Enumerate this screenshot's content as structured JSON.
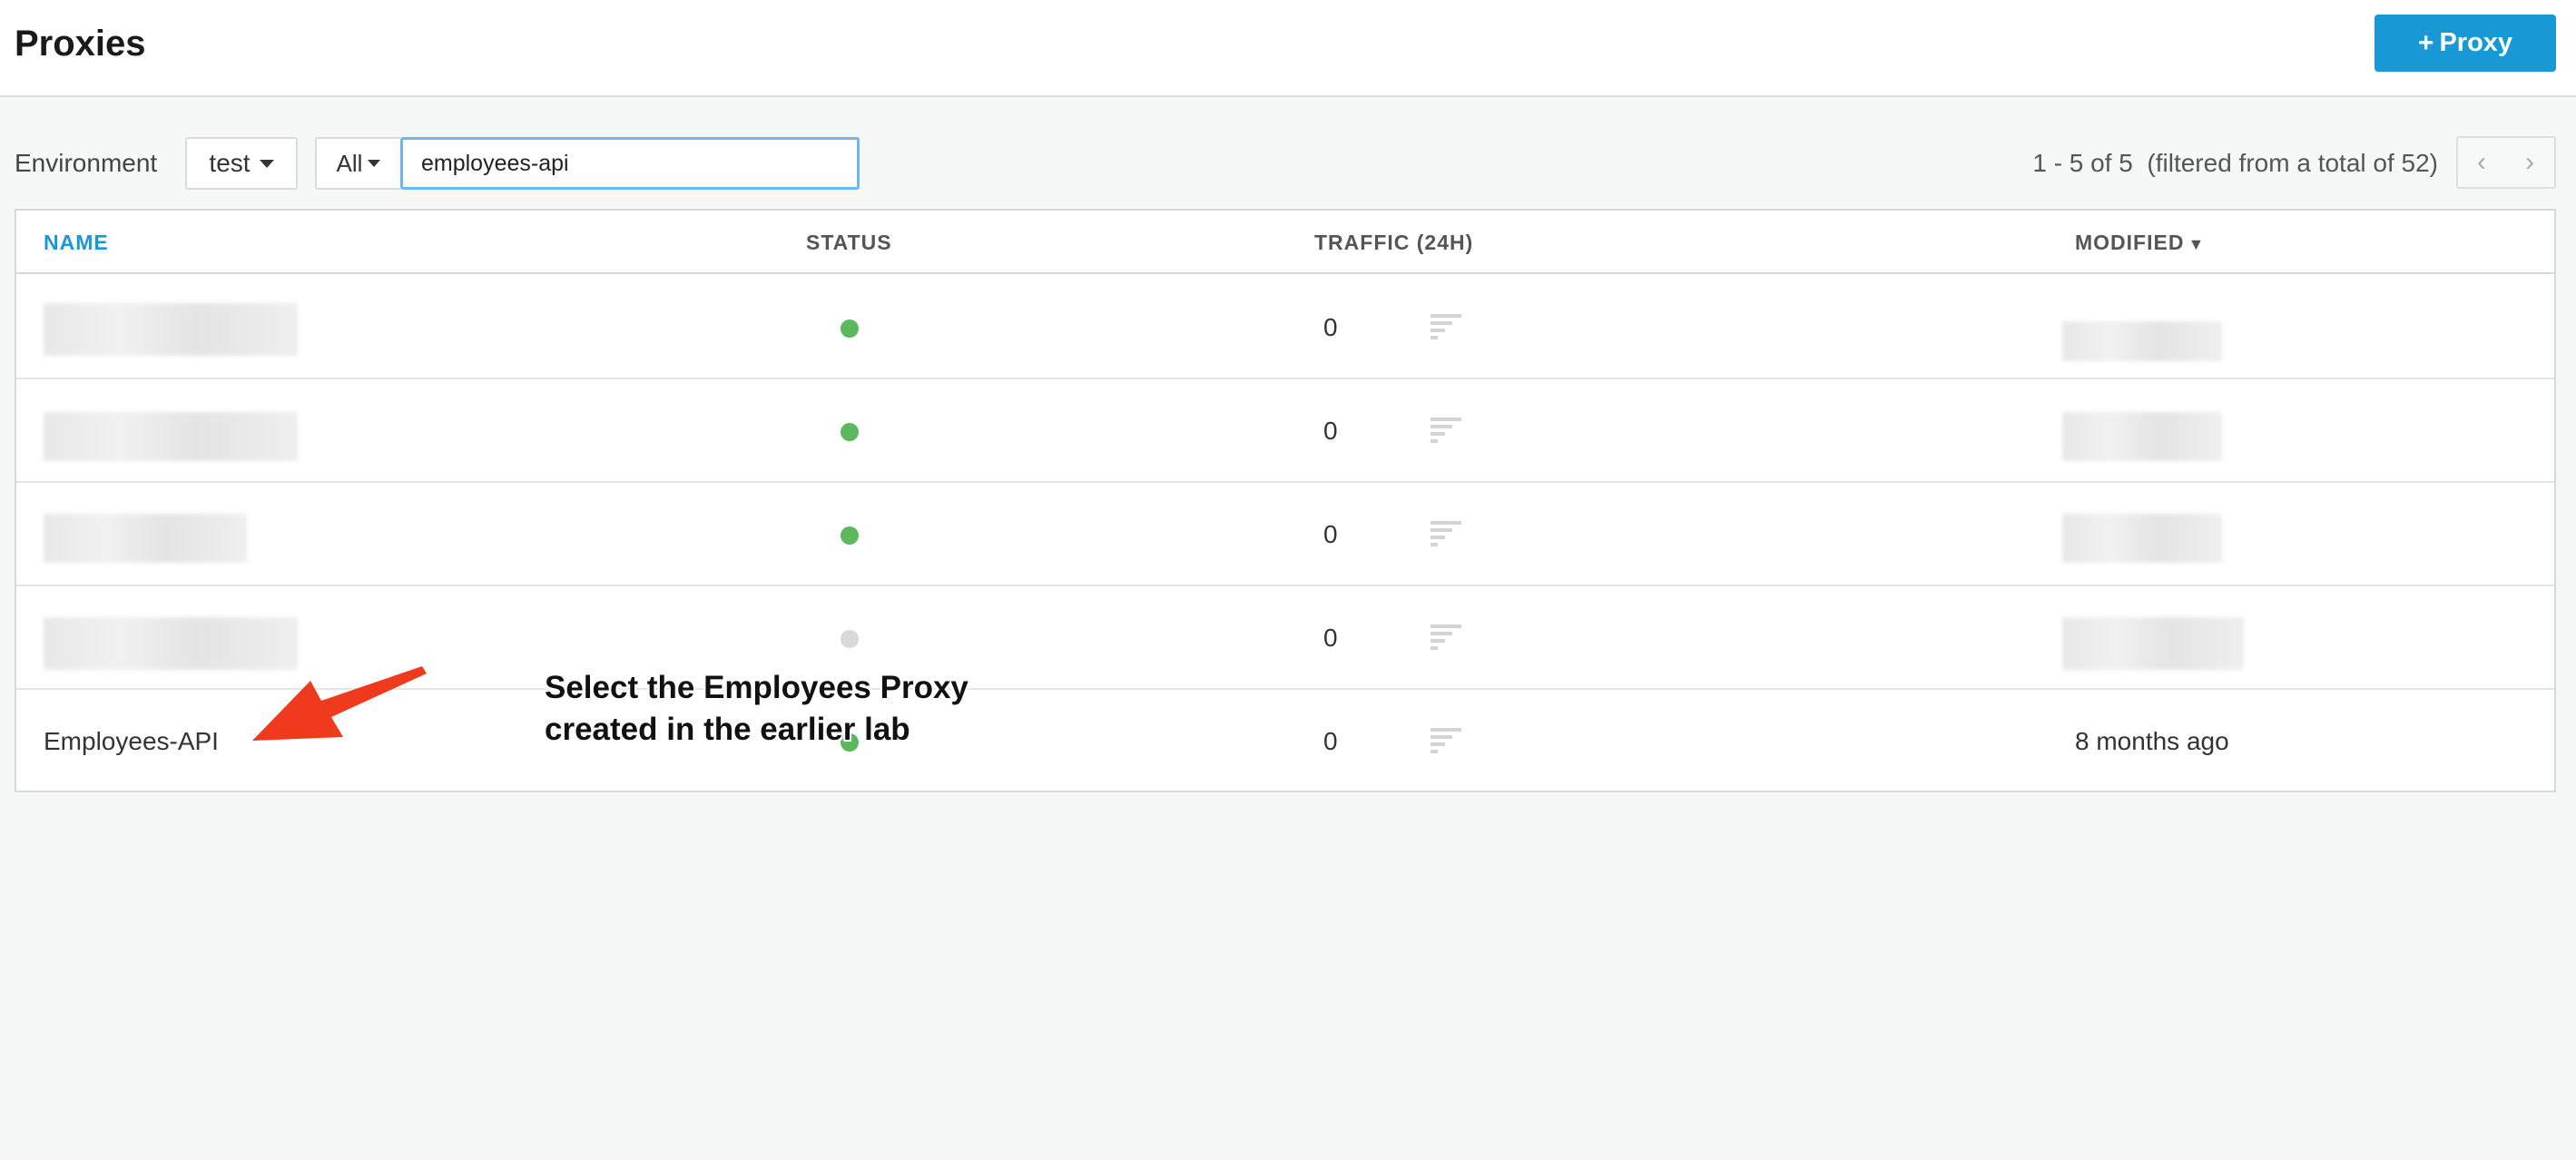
{
  "header": {
    "title": "Proxies",
    "add_button_label": "Proxy",
    "add_button_icon": "plus-icon",
    "accent_color": "#1898d5"
  },
  "toolbar": {
    "environment_label": "Environment",
    "environment_value": "test",
    "filter_value": "All",
    "search_value": "employees-api",
    "pager_text": "1 - 5 of 5  (filtered from a total of 52)"
  },
  "table": {
    "columns": {
      "name": "NAME",
      "status": "STATUS",
      "traffic": "TRAFFIC (24H)",
      "modified": "MODIFIED",
      "modified_sort_icon": "▼"
    },
    "rows": [
      {
        "name": "",
        "status": "deployed",
        "status_color": "#5cb85c",
        "traffic": "0",
        "modified": ""
      },
      {
        "name": "",
        "status": "deployed",
        "status_color": "#5cb85c",
        "traffic": "0",
        "modified": ""
      },
      {
        "name": "",
        "status": "deployed",
        "status_color": "#5cb85c",
        "traffic": "0",
        "modified": ""
      },
      {
        "name": "",
        "status": "undeployed",
        "status_color": "#d9d9d9",
        "traffic": "0",
        "modified": ""
      },
      {
        "name": "Employees-API",
        "status": "deployed",
        "status_color": "#5cb85c",
        "traffic": "0",
        "modified": "8 months ago"
      }
    ]
  },
  "annotation": {
    "line1": "Select the Employees Proxy",
    "line2": "created in the earlier lab",
    "arrow_color": "#f03a1e"
  }
}
